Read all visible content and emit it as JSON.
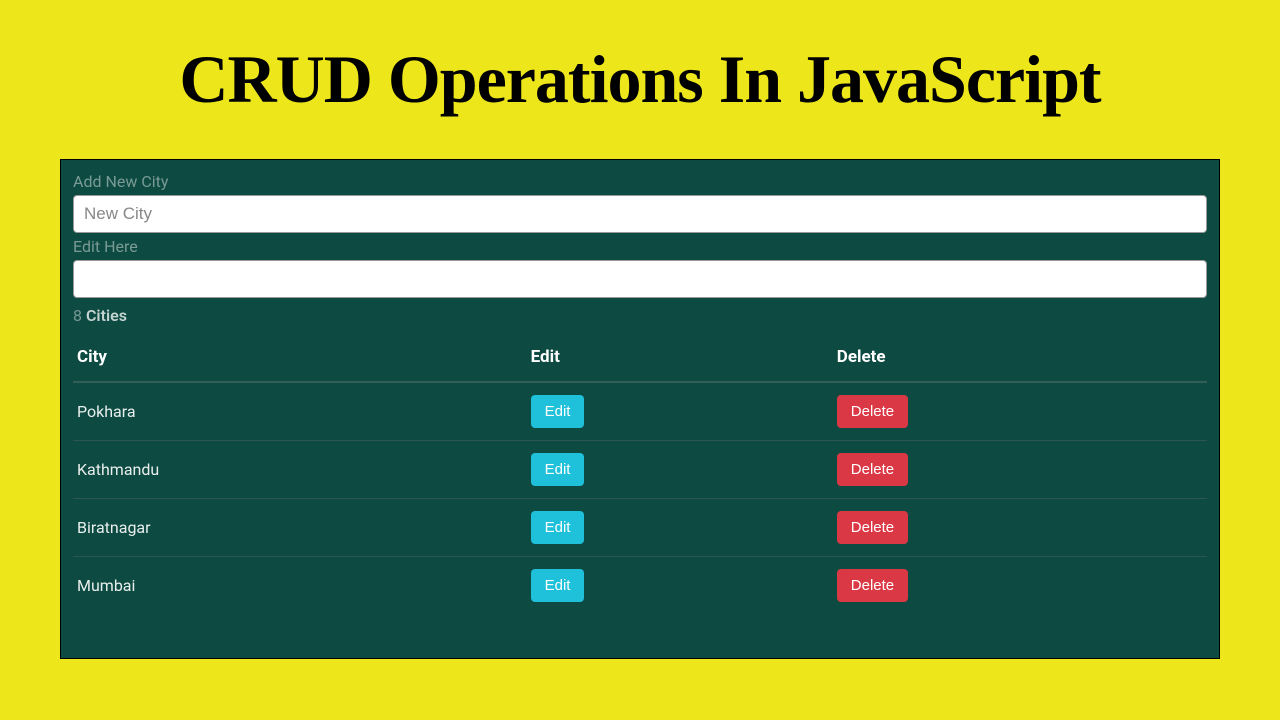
{
  "title": "CRUD Operations In JavaScript",
  "panel": {
    "add_label": "Add New City",
    "add_placeholder": "New City",
    "add_value": "",
    "edit_label": "Edit Here",
    "edit_value": "",
    "count_number": "8",
    "count_word": "Cities"
  },
  "table": {
    "headers": {
      "city": "City",
      "edit": "Edit",
      "delete": "Delete"
    },
    "edit_button_label": "Edit",
    "delete_button_label": "Delete",
    "rows": [
      {
        "city": "Pokhara"
      },
      {
        "city": "Kathmandu"
      },
      {
        "city": "Biratnagar"
      },
      {
        "city": "Mumbai"
      }
    ]
  }
}
